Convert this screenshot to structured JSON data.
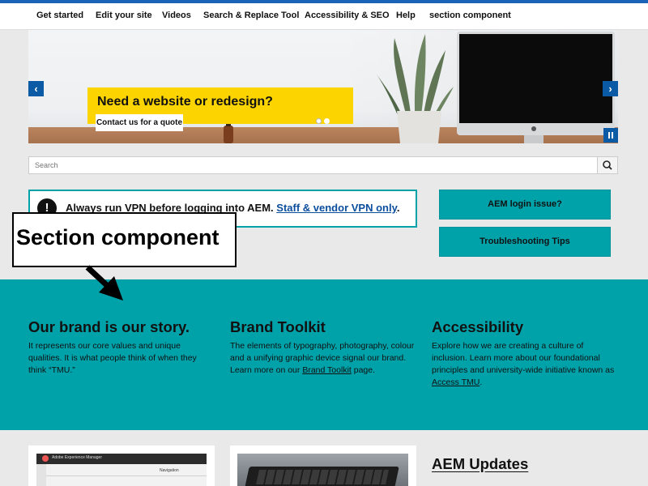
{
  "nav": {
    "items": [
      "Get started",
      "Edit your site",
      "Videos",
      "Search & Replace Tool",
      "Accessibility & SEO",
      "Help",
      "section component"
    ]
  },
  "hero": {
    "promo_title": "Need a website or redesign?",
    "promo_button": "Contact us for a quote",
    "prev_icon": "chevron-left-icon",
    "next_icon": "chevron-right-icon",
    "slide_count": 2,
    "active_slide": 2
  },
  "search": {
    "placeholder": "Search"
  },
  "alert": {
    "icon": "!",
    "text": "Always run VPN before logging into AEM.",
    "link": "Staff & vendor VPN only",
    "suffix": "."
  },
  "buttons": {
    "login_issue": "AEM login issue?",
    "troubleshooting": "Troubleshooting Tips"
  },
  "annotation": {
    "label": "Section component"
  },
  "section": {
    "columns": [
      {
        "title": "Our brand is our story.",
        "body": "It represents our core values and unique qualities. It is what people think of when they think “TMU.”",
        "link": "",
        "tail": ""
      },
      {
        "title": "Brand Toolkit",
        "body": "The elements of typography, photography, colour and a unifying graphic device signal our brand. Learn more on our ",
        "link": "Brand Toolkit",
        "tail": " page."
      },
      {
        "title": "Accessibility",
        "body": "Explore how we are creating a culture of inclusion. Learn more about our foundational principles and university-wide initiative known as ",
        "link": "Access TMU",
        "tail": "."
      }
    ]
  },
  "cards": {
    "aem_app_title": "Adobe Experience Manager",
    "aem_nav_label": "Navigation",
    "updates_title": "AEM Updates"
  },
  "colors": {
    "brand_blue": "#1a63b6",
    "teal": "#00a2aa",
    "promo_yellow": "#fcd500"
  }
}
